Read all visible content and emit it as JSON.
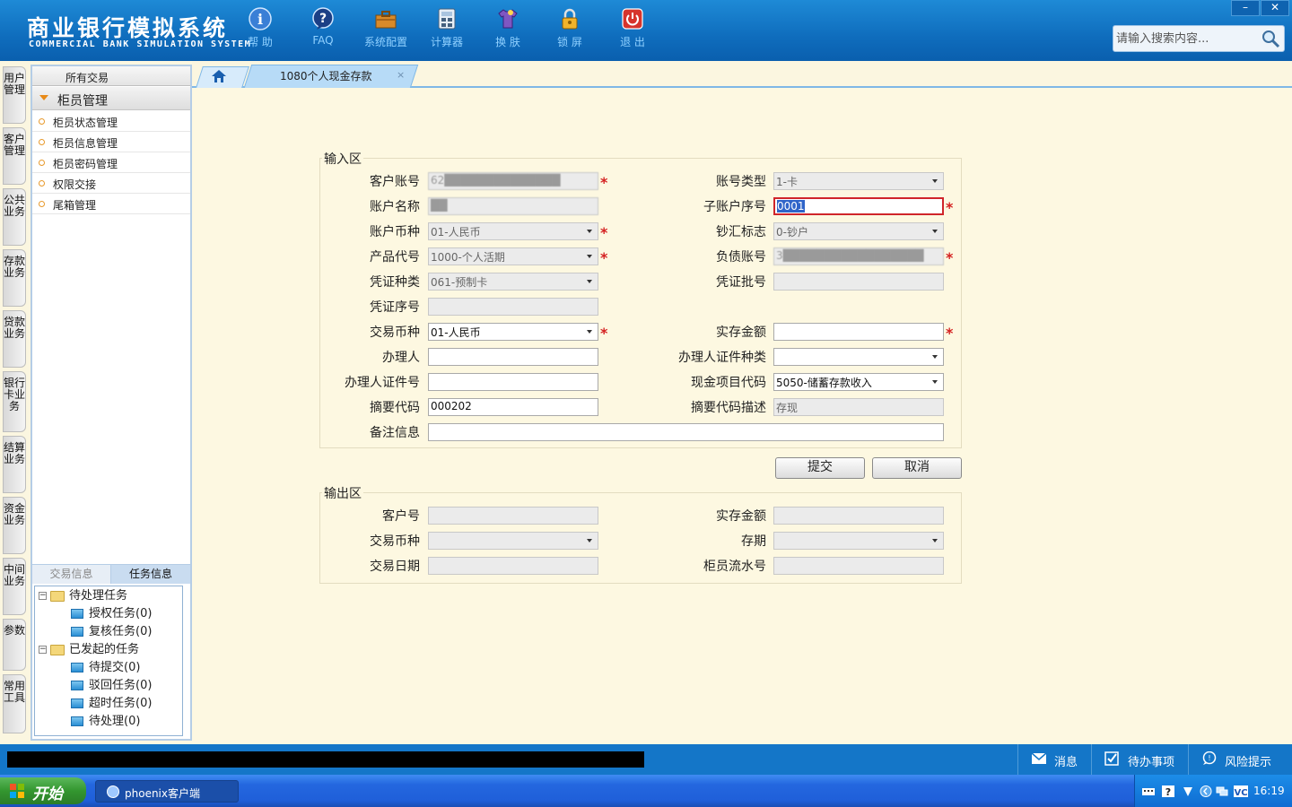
{
  "app": {
    "title": "商业银行模拟系统",
    "subtitle": "COMMERCIAL BANK SIMULATION SYSTEM"
  },
  "toolbar": [
    {
      "label": "帮 助",
      "icon": "help-icon"
    },
    {
      "label": "FAQ",
      "icon": "faq-icon"
    },
    {
      "label": "系统配置",
      "icon": "toolbox-icon"
    },
    {
      "label": "计算器",
      "icon": "calculator-icon"
    },
    {
      "label": "换 肤",
      "icon": "tshirt-icon"
    },
    {
      "label": "锁 屏",
      "icon": "lock-icon"
    },
    {
      "label": "退 出",
      "icon": "power-icon"
    }
  ],
  "search": {
    "placeholder": "请输入搜索内容..."
  },
  "window_controls": {
    "minimize": "–",
    "close": "✕"
  },
  "vertical_nav": [
    "用户管理",
    "客户管理",
    "公共业务",
    "存款业务",
    "贷款业务",
    "银行卡业务",
    "结算业务",
    "资金业务",
    "中间业务",
    "参数",
    "常用工具"
  ],
  "sidebar": {
    "header": "所有交易",
    "group": "柜员管理",
    "items": [
      "柜员状态管理",
      "柜员信息管理",
      "柜员密码管理",
      "权限交接",
      "尾箱管理"
    ],
    "bottom_tabs": [
      "交易信息",
      "任务信息"
    ],
    "tree": {
      "pending": {
        "label": "待处理任务",
        "children": [
          "授权任务(0)",
          "复核任务(0)"
        ]
      },
      "initiated": {
        "label": "已发起的任务",
        "children": [
          "待提交(0)",
          "驳回任务(0)",
          "超时任务(0)",
          "待处理(0)"
        ]
      }
    }
  },
  "tabs": {
    "active_label": "1080个人现金存款",
    "close": "×"
  },
  "input_section": {
    "legend": "输入区",
    "fields": {
      "account_no": {
        "label": "客户账号",
        "value": "62██████████████"
      },
      "account_type": {
        "label": "账号类型",
        "value": "1-卡"
      },
      "account_name": {
        "label": "账户名称",
        "value": "██"
      },
      "sub_account_seq": {
        "label": "子账户序号",
        "value": "0001"
      },
      "account_currency": {
        "label": "账户币种",
        "value": "01-人民币"
      },
      "cash_remit_flag": {
        "label": "钞汇标志",
        "value": "0-钞户"
      },
      "product_code": {
        "label": "产品代号",
        "value": "1000-个人活期"
      },
      "liability_account": {
        "label": "负债账号",
        "value": "3█████████████████"
      },
      "voucher_type": {
        "label": "凭证种类",
        "value": "061-预制卡"
      },
      "voucher_batch": {
        "label": "凭证批号",
        "value": ""
      },
      "voucher_seq": {
        "label": "凭证序号",
        "value": ""
      },
      "trans_currency": {
        "label": "交易币种",
        "value": "01-人民币"
      },
      "deposit_amount": {
        "label": "实存金额",
        "value": ""
      },
      "agent": {
        "label": "办理人",
        "value": ""
      },
      "agent_id_type": {
        "label": "办理人证件种类",
        "value": ""
      },
      "agent_id_no": {
        "label": "办理人证件号",
        "value": ""
      },
      "cash_item_code": {
        "label": "现金项目代码",
        "value": "5050-储蓄存款收入"
      },
      "summary_code": {
        "label": "摘要代码",
        "value": "000202"
      },
      "summary_desc": {
        "label": "摘要代码描述",
        "value": "存现"
      },
      "remark": {
        "label": "备注信息",
        "value": ""
      }
    },
    "required_mark": "*"
  },
  "buttons": {
    "submit": "提交",
    "cancel": "取消"
  },
  "output_section": {
    "legend": "输出区",
    "fields": {
      "customer_no": {
        "label": "客户号",
        "value": ""
      },
      "deposit_amount": {
        "label": "实存金额",
        "value": ""
      },
      "trans_currency": {
        "label": "交易币种",
        "value": ""
      },
      "term": {
        "label": "存期",
        "value": ""
      },
      "trans_date": {
        "label": "交易日期",
        "value": ""
      },
      "teller_serial": {
        "label": "柜员流水号",
        "value": ""
      }
    }
  },
  "statusbar": {
    "messages": "消息",
    "todo": "待办事项",
    "risk": "风险提示"
  },
  "taskbar": {
    "start": "开始",
    "app_button": "phoenix客户端",
    "clock": "16:19"
  },
  "colors": {
    "header_blue": "#0f6dbd",
    "content_bg": "#fdf8e1",
    "required_red": "#d42020",
    "focus_red": "#d0252a"
  }
}
